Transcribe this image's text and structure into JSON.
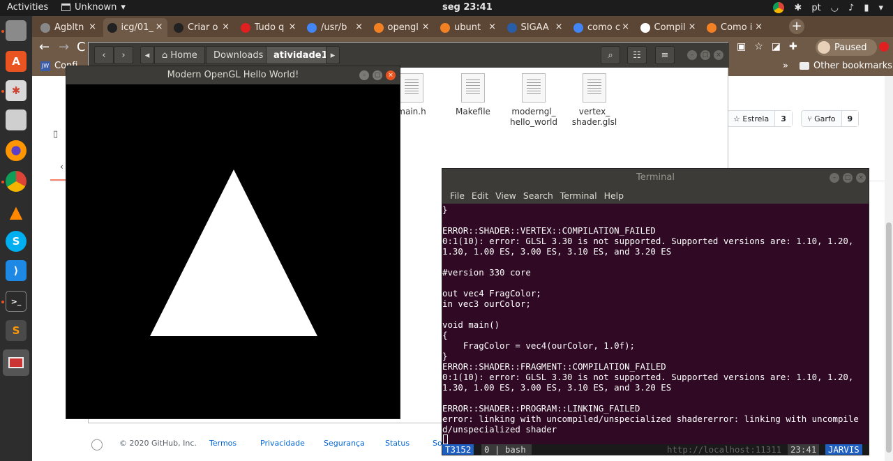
{
  "topbar": {
    "activities": "Activities",
    "app": "Unknown",
    "clock": "seg 23:41",
    "lang": "pt"
  },
  "browser": {
    "tabs": [
      {
        "label": "Agbltn",
        "color": "#888888"
      },
      {
        "label": "icg/01_",
        "color": "#222222"
      },
      {
        "label": "Criar o",
        "color": "#222222"
      },
      {
        "label": "Tudo q",
        "color": "#e02020"
      },
      {
        "label": "/usr/b",
        "color": "#4285f4"
      },
      {
        "label": "opengl",
        "color": "#f48024"
      },
      {
        "label": "ubunt",
        "color": "#f48024"
      },
      {
        "label": "SIGAA",
        "color": "#2a5da8"
      },
      {
        "label": "como c",
        "color": "#4285f4"
      },
      {
        "label": "Compil",
        "color": "#ffffff"
      },
      {
        "label": "Como i",
        "color": "#f48024"
      }
    ],
    "paused": "Paused",
    "bookmark_first": "Confi",
    "bookmark_chevron": "»",
    "other_bookmarks": "Other bookmarks"
  },
  "github": {
    "star": "Estrela",
    "star_count": "3",
    "fork": "Garfo",
    "fork_count": "9",
    "footer": {
      "copyright": "© 2020 GitHub, Inc.",
      "links": [
        "Termos",
        "Privacidade",
        "Segurança",
        "Status",
        "So"
      ]
    }
  },
  "files": {
    "breadcrumbs": [
      "Home",
      "Downloads",
      "atividade1"
    ],
    "items": [
      {
        "name": "main.h",
        "line2": ""
      },
      {
        "name": "Makefile",
        "line2": ""
      },
      {
        "name": "moderngl_",
        "line2": "hello_world"
      },
      {
        "name": "vertex_",
        "line2": "shader.glsl"
      }
    ]
  },
  "opengl_window": {
    "title": "Modern OpenGL Hello World!"
  },
  "terminal": {
    "title": "Terminal",
    "menu": [
      "File",
      "Edit",
      "View",
      "Search",
      "Terminal",
      "Help"
    ],
    "lines": [
      "}",
      "",
      "ERROR::SHADER::VERTEX::COMPILATION_FAILED",
      "0:1(10): error: GLSL 3.30 is not supported. Supported versions are: 1.10, 1.20,",
      "1.30, 1.00 ES, 3.00 ES, 3.10 ES, and 3.20 ES",
      "",
      "#version 330 core",
      "",
      "out vec4 FragColor;",
      "in vec3 ourColor;",
      "",
      "void main()",
      "{",
      "    FragColor = vec4(ourColor, 1.0f);",
      "}",
      "ERROR::SHADER::FRAGMENT::COMPILATION_FAILED",
      "0:1(10): error: GLSL 3.30 is not supported. Supported versions are: 1.10, 1.20,",
      "1.30, 1.00 ES, 3.00 ES, 3.10 ES, and 3.20 ES",
      "",
      "ERROR::SHADER::PROGRAM::LINKING_FAILED",
      "error: linking with uncompiled/unspecialized shadererror: linking with uncompile",
      "d/unspecialized shader",
      ""
    ],
    "status": {
      "session": "T3152",
      "window": "0 | bash",
      "url": "http://localhost:11311",
      "time": "23:41",
      "host": "JARVIS"
    }
  },
  "colors": {
    "terminal_bg": "#300a24",
    "tmux_blue": "#1f5fbf",
    "browser_frame": "#5b4636"
  }
}
